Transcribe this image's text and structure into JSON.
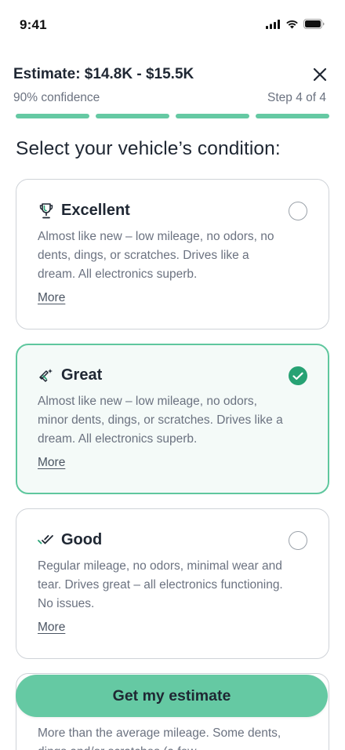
{
  "status_bar": {
    "time": "9:41",
    "icons": [
      "signal-icon",
      "wifi-icon",
      "battery-icon"
    ]
  },
  "header": {
    "estimate": "Estimate: $14.8K - $15.5K",
    "confidence": "90% confidence",
    "step": "Step 4 of 4",
    "close_icon": "close-icon"
  },
  "progress": {
    "total_steps": 4,
    "completed_steps": 4,
    "color": "#65c9a3"
  },
  "question": "Select your vehicle’s condition:",
  "options": [
    {
      "title": "Excellent",
      "icon": "trophy-icon",
      "description": "Almost like new – low mileage, no odors, no dents, dings, or scratches. Drives like a dream. All electronics superb.",
      "more": "More",
      "selected": false
    },
    {
      "title": "Great",
      "icon": "sparkle-tag-icon",
      "description": "Almost like new – low mileage, no odors, minor dents, dings, or scratches. Drives like a dream. All electronics superb.",
      "more": "More",
      "selected": true
    },
    {
      "title": "Good",
      "icon": "double-check-icon",
      "description": "Regular mileage, no odors, minimal wear and tear. Drives great – all electronics functioning. No issues.",
      "more": "More",
      "selected": false
    },
    {
      "description": "More than the average mileage. Some dents, dings and/or scratches (a few"
    }
  ],
  "cta": {
    "label": "Get my estimate"
  },
  "colors": {
    "accent": "#65c9a3",
    "selected_check": "#27a274",
    "selected_border": "#5fc79e",
    "selected_bg": "#f4faf8",
    "text_primary": "#1f2733",
    "text_secondary": "#6b7280"
  }
}
